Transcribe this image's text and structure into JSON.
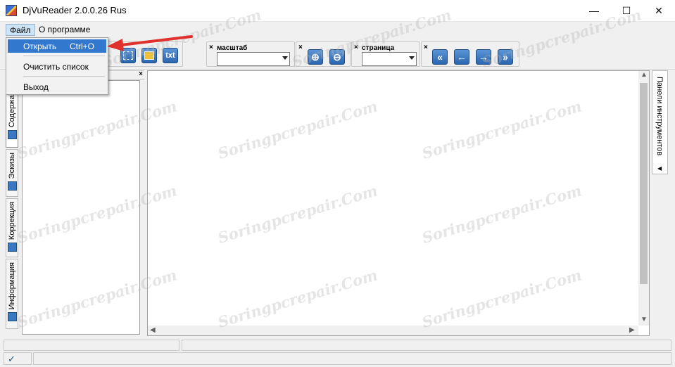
{
  "window": {
    "title": "DjVuReader 2.0.0.26 Rus",
    "controls": {
      "minimize": "—",
      "maximize": "☐",
      "close": "✕"
    }
  },
  "menubar": {
    "items": [
      {
        "label": "Файл"
      },
      {
        "label": "О программе"
      }
    ]
  },
  "dropdown": {
    "items": [
      {
        "label": "Открыть",
        "shortcut": "Ctrl+O",
        "selected": true
      },
      {
        "label": "Очистить список"
      },
      {
        "label": "Выход"
      }
    ]
  },
  "toolbar": {
    "view_buttons": [
      "select-area-icon",
      "image-icon",
      "txt"
    ],
    "zoom_group": {
      "close": "×",
      "label": "масштаб",
      "value": ""
    },
    "zoom_buttons": [
      "zoom-in-icon",
      "zoom-out-icon"
    ],
    "page_group": {
      "close": "×",
      "label": "страница",
      "value": ""
    },
    "nav_buttons": [
      "first-page-icon",
      "prev-page-icon",
      "next-page-icon",
      "last-page-icon"
    ],
    "txt_label": "txt",
    "group_close": "×"
  },
  "left_panel": {
    "close": "×",
    "tabs": [
      {
        "label": "Содержание",
        "icon": "contents-icon"
      },
      {
        "label": "Эскизы",
        "icon": "thumbnails-icon"
      },
      {
        "label": "Коррекция",
        "icon": "wrench-icon"
      },
      {
        "label": "Информация",
        "icon": "info-icon"
      }
    ]
  },
  "right_panel": {
    "label": "Панели инструментов"
  },
  "status_bar": {
    "icon": "check-icon"
  },
  "watermark": "Soringpcrepair.Com",
  "accent_color": "#3378cf",
  "annotation_color": "#e0322d"
}
